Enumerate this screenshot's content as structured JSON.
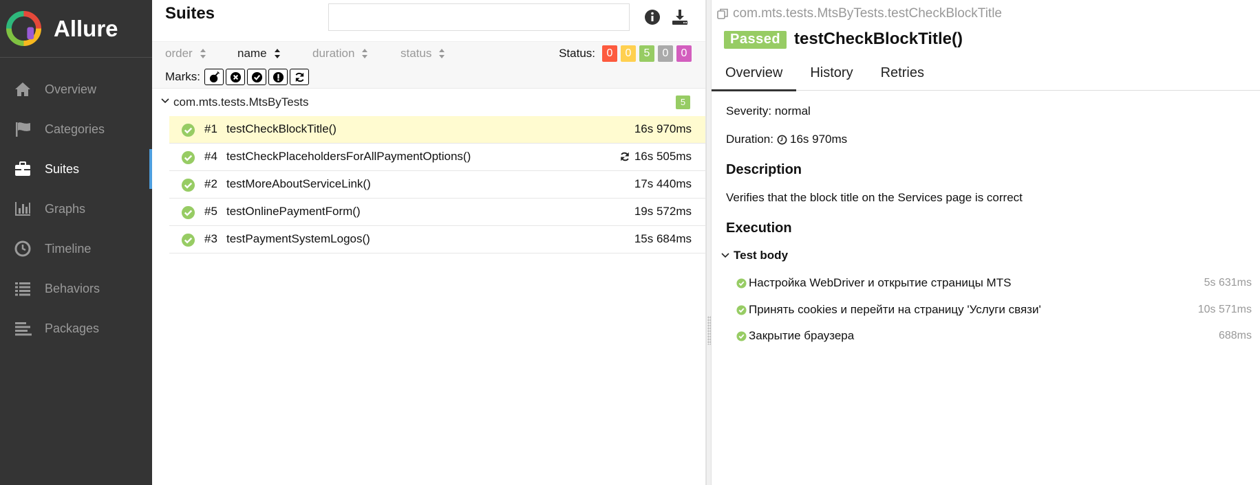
{
  "app": {
    "name": "Allure"
  },
  "sidebar": {
    "items": [
      {
        "label": "Overview",
        "icon": "home-icon",
        "active": false
      },
      {
        "label": "Categories",
        "icon": "flag-icon",
        "active": false
      },
      {
        "label": "Suites",
        "icon": "briefcase-icon",
        "active": true
      },
      {
        "label": "Graphs",
        "icon": "bar-chart-icon",
        "active": false
      },
      {
        "label": "Timeline",
        "icon": "clock-icon",
        "active": false
      },
      {
        "label": "Behaviors",
        "icon": "list-icon",
        "active": false
      },
      {
        "label": "Packages",
        "icon": "align-left-icon",
        "active": false
      }
    ]
  },
  "suites": {
    "title": "Suites",
    "search": {
      "value": "",
      "placeholder": ""
    },
    "sort": {
      "order": "order",
      "name": "name",
      "duration": "duration",
      "status": "status"
    },
    "status_label": "Status:",
    "status_counts": [
      {
        "value": "0",
        "color": "#fd5a3e"
      },
      {
        "value": "0",
        "color": "#ffd050"
      },
      {
        "value": "5",
        "color": "#97cc64"
      },
      {
        "value": "0",
        "color": "#aaaaaa"
      },
      {
        "value": "0",
        "color": "#d35ebe"
      }
    ],
    "marks_label": "Marks:",
    "group": {
      "name": "com.mts.tests.MtsByTests",
      "count": "5"
    },
    "rows": [
      {
        "num": "#1",
        "name": "testCheckBlockTitle()",
        "duration": "16s 970ms",
        "retried": false,
        "selected": true
      },
      {
        "num": "#4",
        "name": "testCheckPlaceholdersForAllPaymentOptions()",
        "duration": "16s 505ms",
        "retried": true,
        "selected": false
      },
      {
        "num": "#2",
        "name": "testMoreAboutServiceLink()",
        "duration": "17s 440ms",
        "retried": false,
        "selected": false
      },
      {
        "num": "#5",
        "name": "testOnlinePaymentForm()",
        "duration": "19s 572ms",
        "retried": false,
        "selected": false
      },
      {
        "num": "#3",
        "name": "testPaymentSystemLogos()",
        "duration": "15s 684ms",
        "retried": false,
        "selected": false
      }
    ]
  },
  "detail": {
    "breadcrumb": "com.mts.tests.MtsByTests.testCheckBlockTitle",
    "status_badge": "Passed",
    "title": "testCheckBlockTitle()",
    "tabs": [
      "Overview",
      "History",
      "Retries"
    ],
    "severity": "Severity: normal",
    "duration_label": "Duration:",
    "duration_value": "16s 970ms",
    "description_heading": "Description",
    "description": "Verifies that the block title on the Services page is correct",
    "execution_heading": "Execution",
    "test_body_label": "Test body",
    "steps": [
      {
        "name": "Настройка WebDriver и открытие страницы MTS",
        "duration": "5s 631ms"
      },
      {
        "name": "Принять cookies и перейти на страницу 'Услуги связи'",
        "duration": "10s 571ms"
      },
      {
        "name": "Закрытие браузера",
        "duration": "688ms"
      }
    ]
  }
}
